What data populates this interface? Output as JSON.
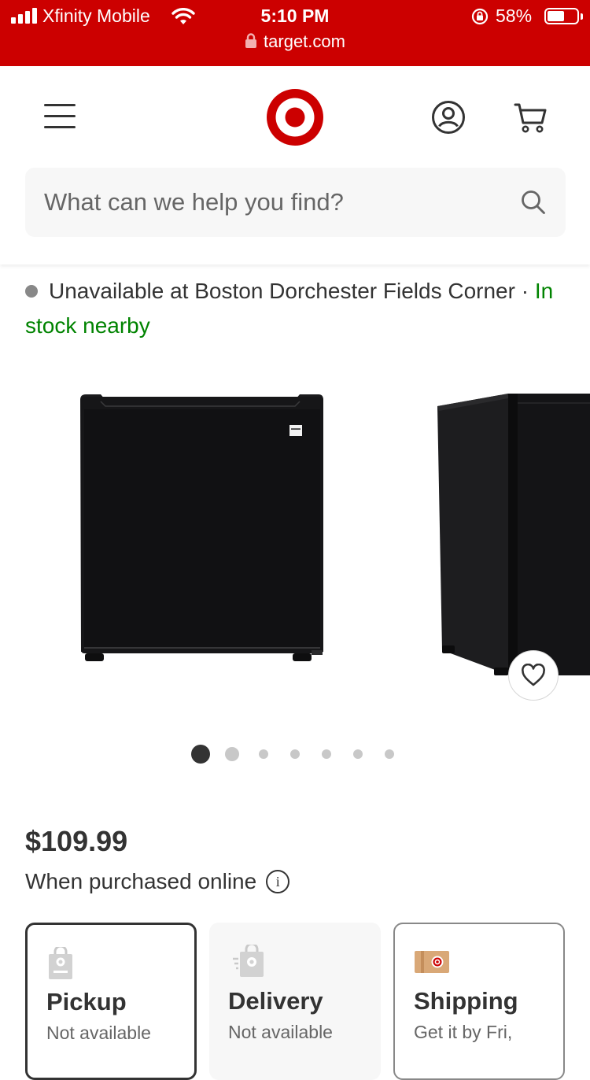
{
  "status_bar": {
    "carrier": "Xfinity Mobile",
    "time": "5:10 PM",
    "battery_percent": "58%",
    "battery_level": 0.58,
    "url": "target.com"
  },
  "header": {
    "logo_icon": "target-bullseye-logo",
    "search": {
      "placeholder": "What can we help you find?"
    }
  },
  "availability": {
    "status": "Unavailable at Boston Dorchester Fields Corner",
    "separator": " · ",
    "nearby_link": "In stock nearby"
  },
  "gallery": {
    "image_count": 7,
    "active_index": 0
  },
  "pricing": {
    "price": "$109.99",
    "note": "When purchased online",
    "info_icon_label": "i"
  },
  "fulfillment": [
    {
      "title": "Pickup",
      "subtitle": "Not available",
      "icon": "pickup-bag-icon"
    },
    {
      "title": "Delivery",
      "subtitle": "Not available",
      "icon": "delivery-bag-icon"
    },
    {
      "title": "Shipping",
      "subtitle": "Get it by Fri,",
      "icon": "shipping-box-icon"
    }
  ],
  "colors": {
    "brand_red": "#cc0000",
    "in_stock_green": "#008300",
    "text_dark": "#333333",
    "text_muted": "#666666"
  }
}
